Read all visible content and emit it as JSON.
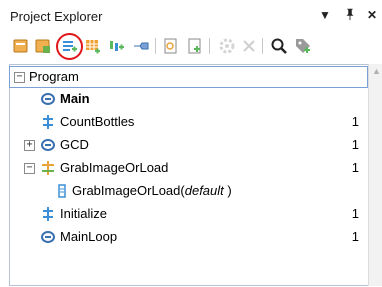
{
  "panel": {
    "title": "Project Explorer",
    "buttons": {
      "menu": "▼",
      "pin": "📌",
      "close": "✕"
    }
  },
  "toolbar": {
    "tools": [
      {
        "name": "new-program-icon",
        "color": "#e8a33a"
      },
      {
        "name": "new-procedure-icon",
        "color": "#e8a33a"
      },
      {
        "name": "new-sequence-icon",
        "color": "#3a8fd8"
      },
      {
        "name": "new-grid-icon",
        "color": "#e8a33a"
      },
      {
        "name": "new-dataflow-icon",
        "color": "#5cb85c"
      },
      {
        "name": "new-block-icon",
        "color": "#3a8fd8"
      },
      {
        "name": "import-icon",
        "color": "#e8a33a"
      },
      {
        "name": "export-icon",
        "color": "#e8a33a"
      },
      {
        "name": "settings-icon",
        "color": "#9a9a9a"
      },
      {
        "name": "delete-icon",
        "color": "#9a9a9a"
      },
      {
        "name": "search-icon",
        "color": "#333333"
      },
      {
        "name": "tag-icon",
        "color": "#5cb85c"
      }
    ],
    "highlight_color": "#e0161b"
  },
  "tree": {
    "root": {
      "label": "Program",
      "expanded": true
    },
    "items": [
      {
        "label": "Main",
        "icon": "loop-icon",
        "count": "",
        "bold": true
      },
      {
        "label": "CountBottles",
        "icon": "sequence-icon",
        "count": "1"
      },
      {
        "label": "GCD",
        "icon": "loop-icon",
        "count": "1",
        "expander": "+"
      },
      {
        "label": "GrabImageOrLoad",
        "icon": "variant-step-icon",
        "count": "1",
        "expander": "−"
      },
      {
        "label": "GrabImageOrLoad(",
        "label_italic": "default",
        "label_suffix": " )",
        "icon": "variant-icon",
        "count": ""
      },
      {
        "label": "Initialize",
        "icon": "sequence-icon",
        "count": "1"
      },
      {
        "label": "MainLoop",
        "icon": "loop-icon",
        "count": "1"
      }
    ]
  }
}
